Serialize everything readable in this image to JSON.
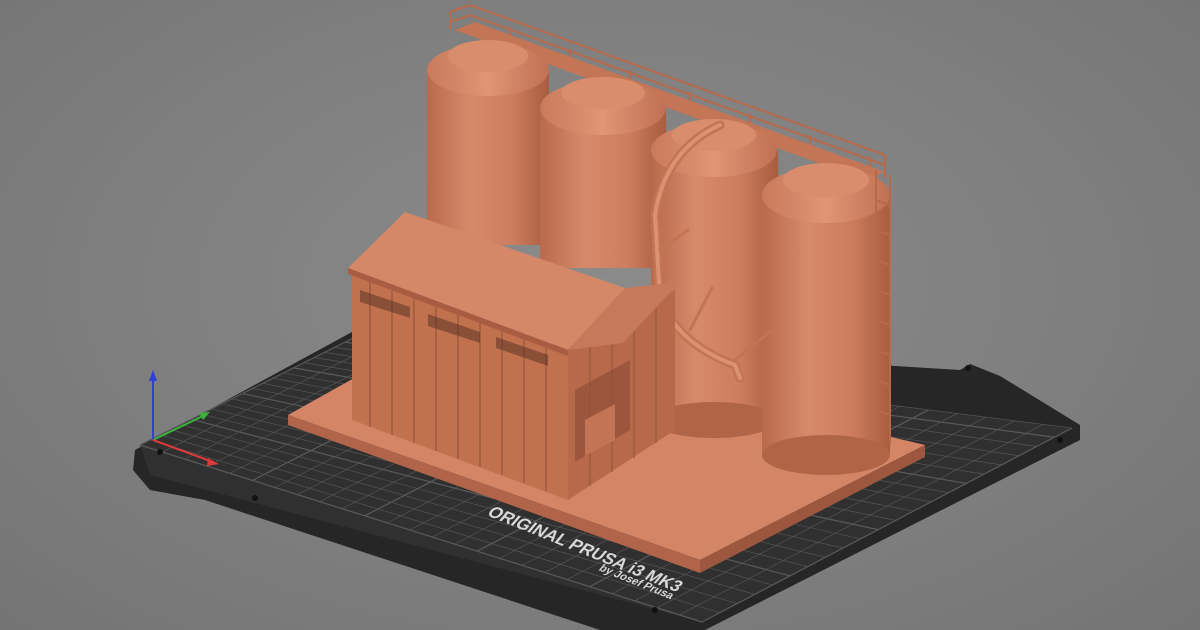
{
  "viewport": {
    "background": "#808080",
    "accent_model_color": "#d6876a"
  },
  "bed": {
    "brand_line": "ORIGINAL PRUSA i3 MK3",
    "sub_line": "by Josef Prusa",
    "plate_color": "#2d2d2d",
    "grid_color": "#5a5a5a"
  },
  "axes": {
    "x_color": "#d83b3b",
    "y_color": "#3bb33b",
    "z_color": "#2f3fd8"
  },
  "model": {
    "name": "grain silo and shed",
    "silo_count": 4
  }
}
